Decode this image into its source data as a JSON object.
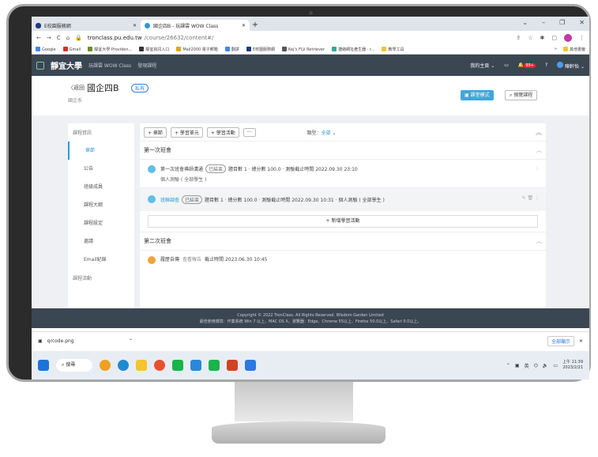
{
  "browser": {
    "tabs": [
      {
        "title": "E校園服務網",
        "active": false
      },
      {
        "title": "國企四B - 玩課雲 WOW Class",
        "active": true
      }
    ],
    "url_host": "tronclass.pu.edu.tw",
    "url_path": "/course/26632/content#/",
    "bookmarks": [
      "Google",
      "Gmail",
      "靜宜大學 Providen...",
      "靜宜資訊入口",
      "Mail2000 電子郵箱",
      "翻譯",
      "E校園服務網",
      "Kej's FLV Retriever",
      "捷絡網址產生器 - r...",
      "教學工具"
    ],
    "other_bookmarks": "其他書籤"
  },
  "app": {
    "university": "靜宜大學",
    "platform": "玩課雲 WOW Class",
    "nav_link": "發現課程",
    "my_home": "我的主頁",
    "notify_badge": "99+",
    "user": "陳軒怡"
  },
  "course": {
    "back": "返回",
    "title": "國企四B",
    "tag": "私有",
    "department": "國企系",
    "teach_mode_btn": "課堂模式",
    "preview_btn": "預覽課程"
  },
  "sidebar": {
    "group1": "課程資訊",
    "items": [
      "章節",
      "公告",
      "班級成員",
      "課程大綱",
      "課程設定",
      "邀請",
      "Email紀錄"
    ],
    "group2": "課程活動"
  },
  "toolbar": {
    "add_chapter": "+ 章節",
    "add_unit": "+ 學習單元",
    "add_activity": "+ 學習活動",
    "more": "···",
    "type_label": "類型：",
    "type_value": "全部"
  },
  "sections": [
    {
      "title": "第一次班會",
      "activities": [
        {
          "name": "第一次班會導師溝通",
          "status": "已結束",
          "line1": "題目數 1 · 總分數 100.0 · 測驗截止時間 2022.09.30 23:10",
          "line2": "個人測驗 ( 全部學生 )"
        },
        {
          "name": "班聯調查",
          "status": "已結束",
          "line1": "題目數 1 · 總分數 100.0 · 測驗截止時間 2022.09.30 10:31 · 個人測驗 ( 全部學生 )",
          "line2": ""
        }
      ],
      "add_label": "+ 新增學習活動"
    },
    {
      "title": "第二次班會",
      "activities": [
        {
          "name": "履歷自傳",
          "status": "查看報告",
          "line1": "截止時間 2023.06.30 10:45",
          "line2": ""
        }
      ]
    }
  ],
  "footer": {
    "line1": "Copyright © 2022 TronClass. All Rights Reserved. Wisdom Garden Limited",
    "line2": "最佳使用環境：作業系統 Win 7 以上，MAC OS X。瀏覽器：Edge、Chrome 55以上、Firefox 50.0以上、Safari 9.0以上。"
  },
  "download_bar": {
    "file": "qrcode.png",
    "show_all": "全部顯示"
  },
  "taskbar": {
    "search": "搜尋",
    "ime": "英",
    "time": "上午 11:39",
    "date": "2023/2/21"
  }
}
